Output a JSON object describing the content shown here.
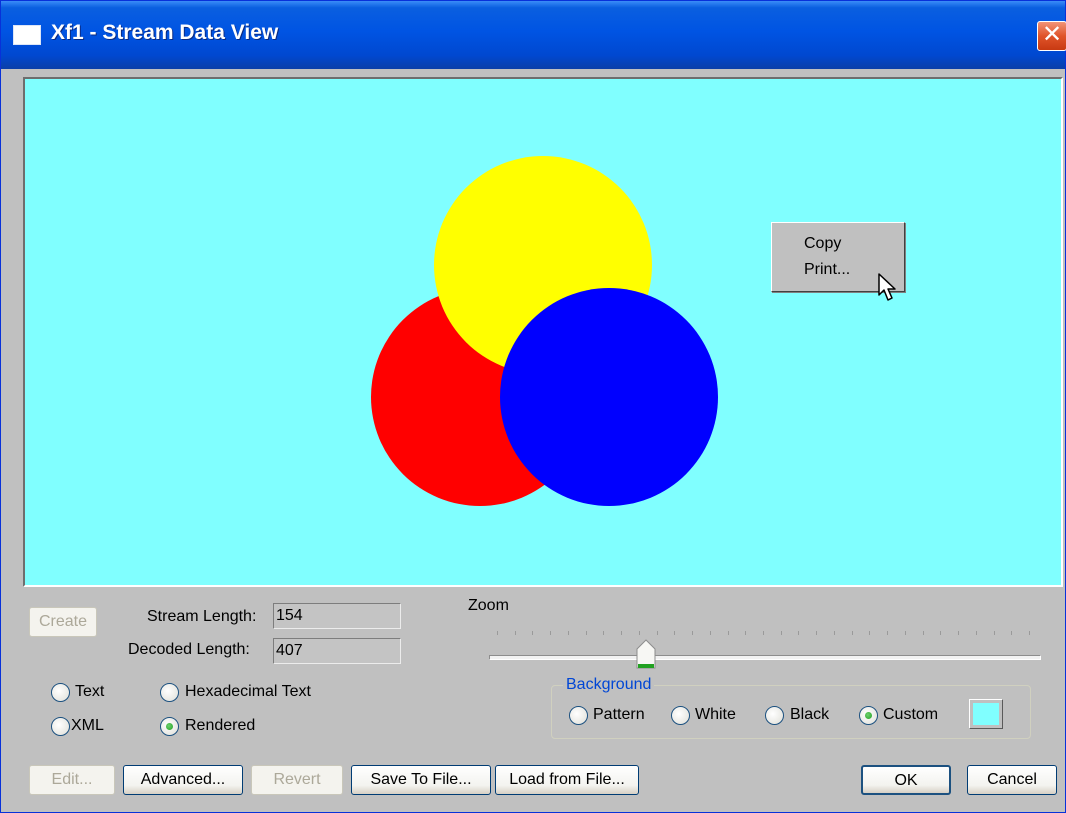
{
  "window": {
    "title": "Xf1 - Stream Data View",
    "close_label": "✕"
  },
  "canvas": {
    "background_color": "#80ffff",
    "shapes": [
      {
        "name": "red-circle",
        "color": "#ff0000"
      },
      {
        "name": "yellow-circle",
        "color": "#ffff00"
      },
      {
        "name": "blue-circle",
        "color": "#0000ff"
      }
    ]
  },
  "context_menu": {
    "items": [
      "Copy",
      "Print..."
    ]
  },
  "stream": {
    "create_label": "Create",
    "stream_length_label": "Stream Length:",
    "stream_length_value": "154",
    "decoded_length_label": "Decoded Length:",
    "decoded_length_value": "407"
  },
  "view_mode": {
    "options": [
      "Text",
      "Hexadecimal Text",
      "XML",
      "Rendered"
    ],
    "selected": "Rendered"
  },
  "zoom": {
    "label": "Zoom",
    "tick_count": 31,
    "position": 0.28
  },
  "background": {
    "label": "Background",
    "options": [
      "Pattern",
      "White",
      "Black",
      "Custom"
    ],
    "selected": "Custom",
    "custom_color": "#80ffff"
  },
  "buttons": {
    "edit": "Edit...",
    "advanced": "Advanced...",
    "revert": "Revert",
    "save_to_file": "Save To File...",
    "load_from_file": "Load from File...",
    "ok": "OK",
    "cancel": "Cancel"
  }
}
